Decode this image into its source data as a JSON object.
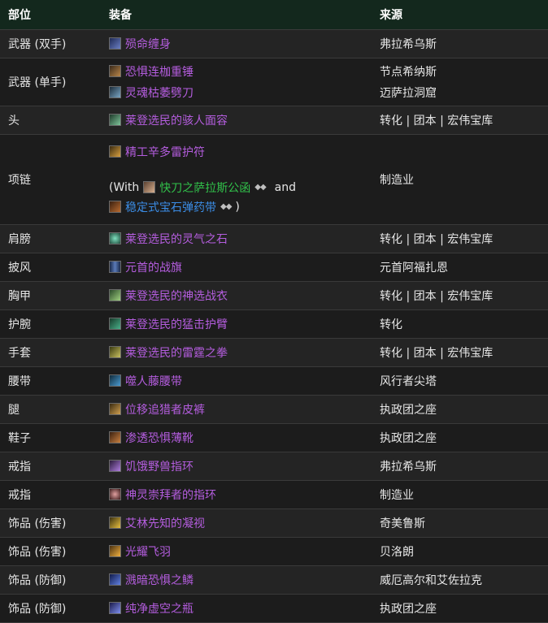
{
  "header": {
    "slot": "部位",
    "item": "装备",
    "source": "来源"
  },
  "colors": {
    "epic": "#b45dde",
    "rare": "#3b8de6",
    "uncommon": "#31c14a",
    "header_bg": "#13281d"
  },
  "rows": [
    {
      "slot": "武器 (双手)",
      "items": [
        {
          "name": "殒命缠身",
          "icon": "staff-icon"
        }
      ],
      "sources": [
        "弗拉希乌斯"
      ]
    },
    {
      "slot": "武器 (单手)",
      "items": [
        {
          "name": "恐惧连枷重锤",
          "icon": "mace-icon"
        },
        {
          "name": "灵魂枯萎劈刀",
          "icon": "axe-icon"
        }
      ],
      "sources": [
        "节点希纳斯",
        "迈萨拉洞窟"
      ]
    },
    {
      "slot": "头",
      "items": [
        {
          "name": "莱登选民的骇人面容",
          "icon": "helm-icon"
        }
      ],
      "sources": [
        "转化 | 团本 | 宏伟宝库"
      ]
    },
    {
      "slot": "项链",
      "items": [
        {
          "name": "精工辛多雷护符",
          "icon": "amulet-icon"
        }
      ],
      "with": {
        "prefix": "(With",
        "gem_item": "快刀之萨拉斯公函",
        "joiner": "and",
        "second_item": "稳定式宝石弹药带",
        "suffix": ")",
        "gem_marks": "◆◆"
      },
      "sources": [
        "制造业"
      ]
    },
    {
      "slot": "肩膀",
      "items": [
        {
          "name": "莱登选民的灵气之石",
          "icon": "shoulder-icon"
        }
      ],
      "sources": [
        "转化 | 团本 | 宏伟宝库"
      ]
    },
    {
      "slot": "披风",
      "items": [
        {
          "name": "元首的战旗",
          "icon": "cloak-icon"
        }
      ],
      "sources": [
        "元首阿福扎恩"
      ]
    },
    {
      "slot": "胸甲",
      "items": [
        {
          "name": "莱登选民的神选战衣",
          "icon": "chest-icon"
        }
      ],
      "sources": [
        "转化 | 团本 | 宏伟宝库"
      ]
    },
    {
      "slot": "护腕",
      "items": [
        {
          "name": "莱登选民的猛击护臂",
          "icon": "bracer-icon"
        }
      ],
      "sources": [
        "转化"
      ]
    },
    {
      "slot": "手套",
      "items": [
        {
          "name": "莱登选民的雷霆之拳",
          "icon": "gloves-icon"
        }
      ],
      "sources": [
        "转化 | 团本 | 宏伟宝库"
      ]
    },
    {
      "slot": "腰带",
      "items": [
        {
          "name": "噬人藤腰带",
          "icon": "belt-icon"
        }
      ],
      "sources": [
        "风行者尖塔"
      ]
    },
    {
      "slot": "腿",
      "items": [
        {
          "name": "位移追猎者皮裤",
          "icon": "legs-icon"
        }
      ],
      "sources": [
        "执政团之座"
      ]
    },
    {
      "slot": "鞋子",
      "items": [
        {
          "name": "渗透恐惧薄靴",
          "icon": "boots-icon"
        }
      ],
      "sources": [
        "执政团之座"
      ]
    },
    {
      "slot": "戒指",
      "items": [
        {
          "name": "饥饿野兽指环",
          "icon": "ring-icon"
        }
      ],
      "sources": [
        "弗拉希乌斯"
      ]
    },
    {
      "slot": "戒指",
      "items": [
        {
          "name": "神灵崇拜者的指环",
          "icon": "ring-icon"
        }
      ],
      "sources": [
        "制造业"
      ]
    },
    {
      "slot": "饰品 (伤害)",
      "items": [
        {
          "name": "艾林先知的凝视",
          "icon": "trinket-icon"
        }
      ],
      "sources": [
        "奇美鲁斯"
      ]
    },
    {
      "slot": "饰品 (伤害)",
      "items": [
        {
          "name": "光耀飞羽",
          "icon": "feather-icon"
        }
      ],
      "sources": [
        "贝洛朗"
      ]
    },
    {
      "slot": "饰品 (防御)",
      "items": [
        {
          "name": "溅暗恐惧之鳞",
          "icon": "scale-icon"
        }
      ],
      "sources": [
        "威厄高尔和艾佐拉克"
      ]
    },
    {
      "slot": "饰品 (防御)",
      "items": [
        {
          "name": "纯净虚空之瓶",
          "icon": "vial-icon"
        }
      ],
      "sources": [
        "执政团之座"
      ]
    }
  ]
}
